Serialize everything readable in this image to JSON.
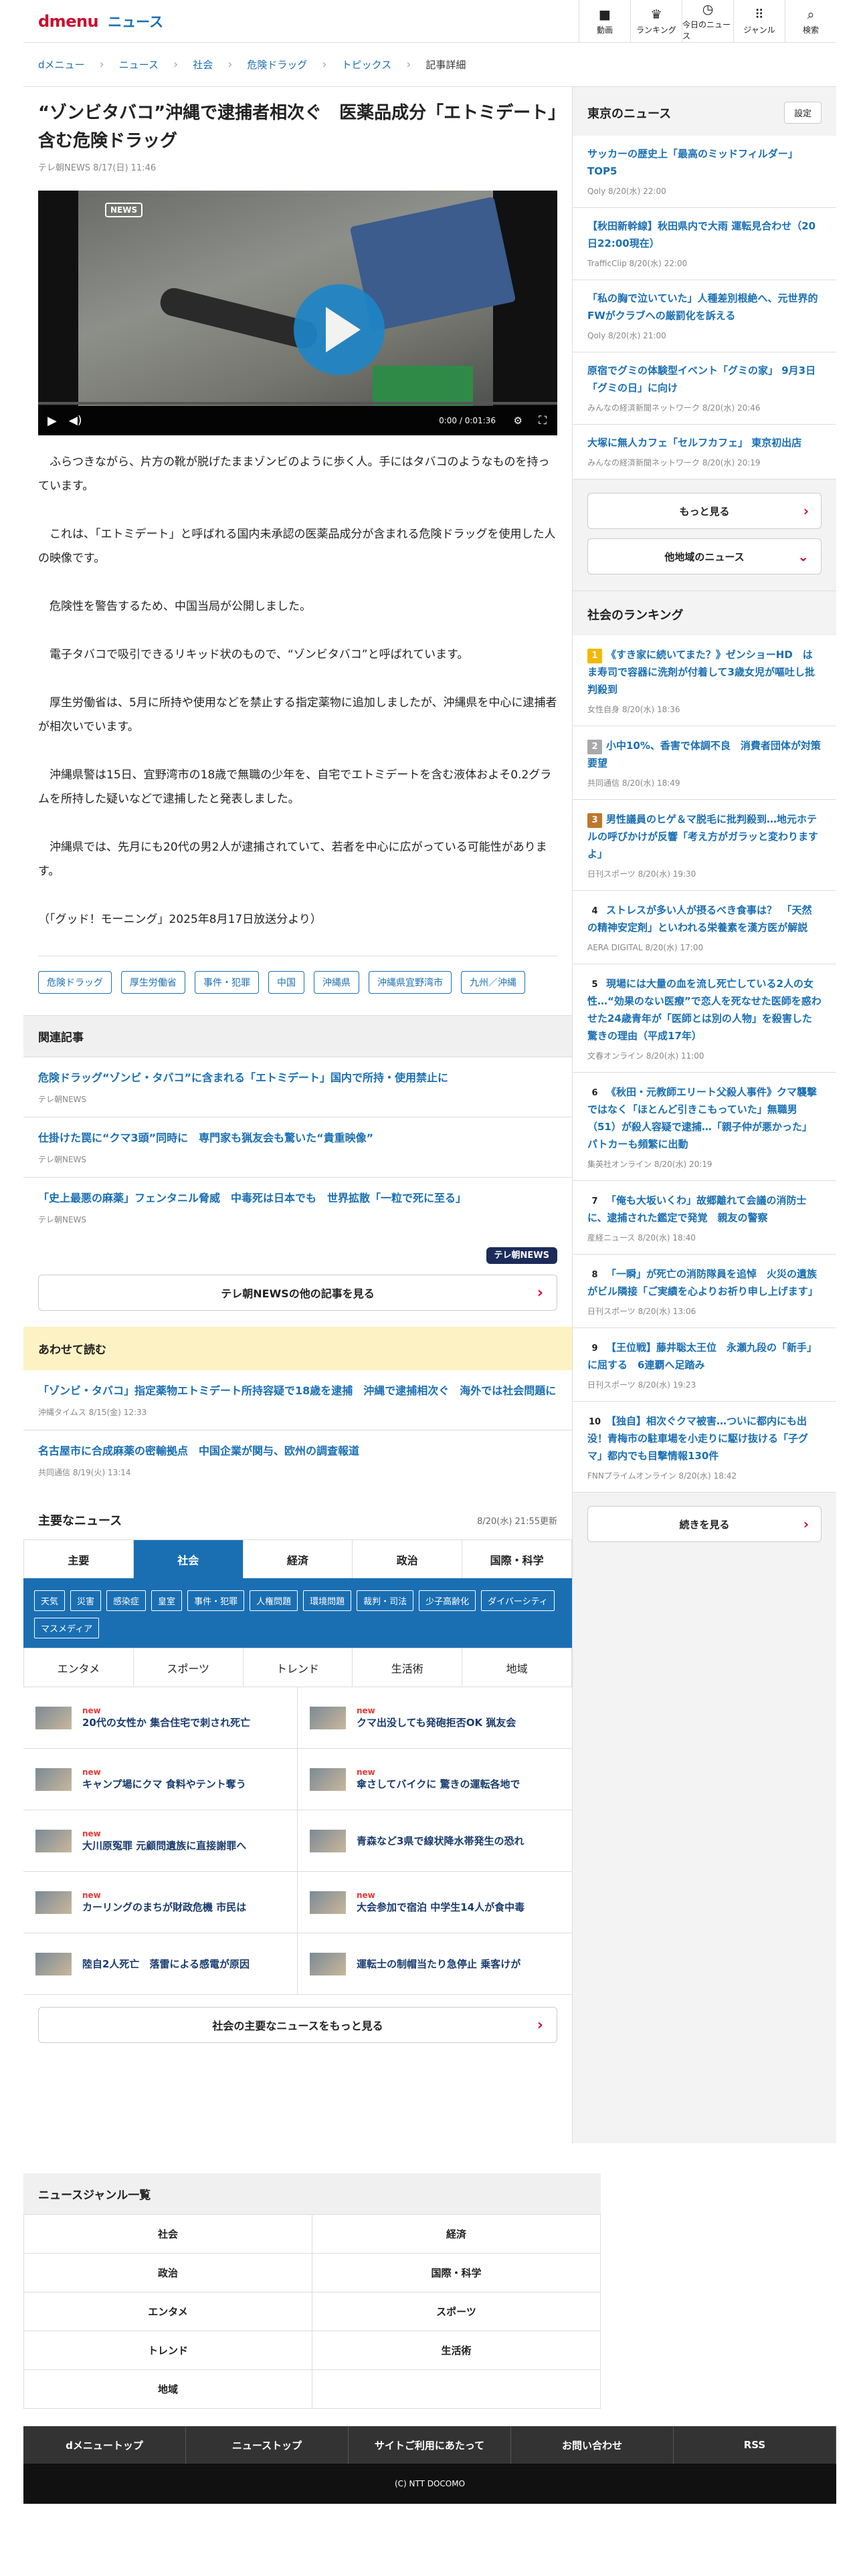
{
  "header": {
    "logo_d": "dmenu",
    "logo_n": "ニュース",
    "nav": [
      {
        "icon": "video-icon",
        "glyph": "■",
        "label": "動画"
      },
      {
        "icon": "trophy-icon",
        "glyph": "♛",
        "label": "ランキング"
      },
      {
        "icon": "clock-icon",
        "glyph": "◷",
        "label": "今日のニュース"
      },
      {
        "icon": "grid-icon",
        "glyph": "⠿",
        "label": "ジャンル"
      },
      {
        "icon": "search-icon",
        "glyph": "⌕",
        "label": "検索"
      }
    ]
  },
  "breadcrumb": [
    "dメニュー",
    "ニュース",
    "社会",
    "危険ドラッグ",
    "トピックス"
  ],
  "breadcrumb_current": "記事詳細",
  "article": {
    "title": "“ゾンビタバコ”沖縄で逮捕者相次ぐ　医薬品成分「エトミデート」含む危険ドラッグ",
    "meta": "テレ朝NEWS 8/17(日) 11:46",
    "video": {
      "badge": "NEWS",
      "time": "0:00 / 0:01:36"
    },
    "paragraphs": [
      "ふらつきながら、片方の靴が脱げたままゾンビのように歩く人。手にはタバコのようなものを持っています。",
      "これは、「エトミデート」と呼ばれる国内未承認の医薬品成分が含まれる危険ドラッグを使用した人の映像です。",
      "危険性を警告するため、中国当局が公開しました。",
      "電子タバコで吸引できるリキッド状のもので、“ゾンビタバコ”と呼ばれています。",
      "厚生労働省は、5月に所持や使用などを禁止する指定薬物に追加しましたが、沖縄県を中心に逮捕者が相次いでいます。",
      "沖縄県警は15日、宜野湾市の18歳で無職の少年を、自宅でエトミデートを含む液体およそ0.2グラムを所持した疑いなどで逮捕したと発表しました。",
      "沖縄県では、先月にも20代の男2人が逮捕されていて、若者を中心に広がっている可能性があります。",
      "（「グッド！モーニング」2025年8月17日放送分より）"
    ],
    "tags": [
      "危険ドラッグ",
      "厚生労働省",
      "事件・犯罪",
      "中国",
      "沖縄県",
      "沖縄県宜野湾市",
      "九州／沖縄"
    ]
  },
  "related": {
    "heading": "関連記事",
    "items": [
      {
        "title": "危険ドラッグ“ゾンビ・タバコ”に含まれる「エトミデート」国内で所持・使用禁止に",
        "src": "テレ朝NEWS"
      },
      {
        "title": "仕掛けた罠に“クマ3頭”同時に　専門家も猟友会も驚いた“貴重映像”",
        "src": "テレ朝NEWS"
      },
      {
        "title": "「史上最悪の麻薬」フェンタニル脅威　中毒死は日本でも　世界拡散「一粒で死に至る」",
        "src": "テレ朝NEWS"
      }
    ],
    "logo": "テレ朝NEWS",
    "more": "テレ朝NEWSの他の記事を見る"
  },
  "also": {
    "heading": "あわせて読む",
    "items": [
      {
        "title": "「ゾンビ・タバコ」指定薬物エトミデート所持容疑で18歳を逮捕　沖縄で逮捕相次ぐ　海外では社会問題に",
        "src": "沖縄タイムス 8/15(金) 12:33"
      },
      {
        "title": "名古屋市に合成麻薬の密輸拠点　中国企業が関与、欧州の調査報道",
        "src": "共同通信 8/19(火) 13:14"
      }
    ]
  },
  "major": {
    "heading": "主要なニュース",
    "updated": "8/20(水) 21:55更新",
    "tabs": [
      "主要",
      "社会",
      "経済",
      "政治",
      "国際・科学"
    ],
    "subtags": [
      "天気",
      "災害",
      "感染症",
      "皇室",
      "事件・犯罪",
      "人権問題",
      "環境問題",
      "裁判・司法",
      "少子高齢化",
      "ダイバーシティ",
      "マスメディア"
    ],
    "tabs2": [
      "エンタメ",
      "スポーツ",
      "トレンド",
      "生活術",
      "地域"
    ],
    "new_label": "new",
    "items": [
      {
        "t": "20代の女性か 集合住宅で刺され死亡",
        "n": true
      },
      {
        "t": "クマ出没しても発砲拒否OK 猟友会",
        "n": true
      },
      {
        "t": "キャンプ場にクマ 食料やテント奪う",
        "n": true
      },
      {
        "t": "傘さしてバイクに 驚きの運転各地で",
        "n": true
      },
      {
        "t": "大川原冤罪 元顧問遺族に直接謝罪へ",
        "n": true
      },
      {
        "t": "青森など3県で線状降水帯発生の恐れ",
        "n": false
      },
      {
        "t": "カーリングのまちが財政危機 市民は",
        "n": true
      },
      {
        "t": "大会参加で宿泊 中学生14人が食中毒",
        "n": true
      },
      {
        "t": "陸自2人死亡　落雷による感電が原因",
        "n": false
      },
      {
        "t": "運転士の制帽当たり急停止 乗客けが",
        "n": false
      }
    ],
    "more": "社会の主要なニュースをもっと見る"
  },
  "genre": {
    "heading": "ニュースジャンル一覧",
    "items": [
      "社会",
      "経済",
      "政治",
      "国際・科学",
      "エンタメ",
      "スポーツ",
      "トレンド",
      "生活術",
      "地域"
    ]
  },
  "footer": {
    "links": [
      "dメニュートップ",
      "ニューストップ",
      "サイトご利用にあたって",
      "お問い合わせ",
      "RSS"
    ],
    "copyright": "(C) NTT DOCOMO"
  },
  "sidebar": {
    "local": {
      "heading": "東京のニュース",
      "setting": "設定",
      "items": [
        {
          "t": "サッカーの歴史上「最高のミッドフィルダー」TOP5",
          "m": "Qoly 8/20(水) 22:00"
        },
        {
          "t": "【秋田新幹線】秋田県内で大雨 運転見合わせ（20日22:00現在）",
          "m": "TrafficClip 8/20(水) 22:00"
        },
        {
          "t": "「私の胸で泣いていた」人種差別根絶へ、元世界的FWがクラブへの厳罰化を訴える",
          "m": "Qoly 8/20(水) 21:00"
        },
        {
          "t": "原宿でグミの体験型イベント「グミの家」 9月3日「グミの日」に向け",
          "m": "みんなの経済新聞ネットワーク 8/20(水) 20:46"
        },
        {
          "t": "大塚に無人カフェ「セルフカフェ」 東京初出店",
          "m": "みんなの経済新聞ネットワーク 8/20(水) 20:19"
        }
      ],
      "more": "もっと見る",
      "other": "他地域のニュース"
    },
    "ranking": {
      "heading": "社会のランキング",
      "items": [
        {
          "n": "1",
          "t": "《すき家に続いてまた？》ゼンショーHD　はま寿司で容器に洗剤が付着して3歳女児が嘔吐し批判殺到",
          "m": "女性自身 8/20(水) 18:36",
          "c": "#f5b800"
        },
        {
          "n": "2",
          "t": "小中10%、香害で体調不良　消費者団体が対策要望",
          "m": "共同通信 8/20(水) 18:49",
          "c": "#a9a9a9"
        },
        {
          "n": "3",
          "t": "男性議員のヒゲ＆マ脱毛に批判殺到…地元ホテルの呼びかけが反響「考え方がガラッと変わりますよ」",
          "m": "日刊スポーツ 8/20(水) 19:30",
          "c": "#c0762d"
        },
        {
          "n": "4",
          "t": "ストレスが多い人が摂るべき食事は？　「天然の精神安定剤」といわれる栄養素を漢方医が解説",
          "m": "AERA DIGITAL 8/20(水) 17:00",
          "c": "#fff"
        },
        {
          "n": "5",
          "t": "現場には大量の血を流し死亡している2人の女性…“効果のない医療”で恋人を死なせた医師を惑わせた24歳青年が「医師とは別の人物」を殺害した驚きの理由（平成17年）",
          "m": "文春オンライン 8/20(水) 11:00",
          "c": "#fff"
        },
        {
          "n": "6",
          "t": "《秋田・元教師エリート父殺人事件》クマ襲撃ではなく「ほとんど引きこもっていた」無職男（51）が殺人容疑で逮捕…「親子仲が悪かった」パトカーも頻繁に出動",
          "m": "集英社オンライン 8/20(水) 20:19",
          "c": "#fff"
        },
        {
          "n": "7",
          "t": "「俺も大坂いくわ」故郷離れて会議の消防士に、逮捕された鑑定で発覚　親友の警察",
          "m": "産経ニュース 8/20(水) 18:40",
          "c": "#fff"
        },
        {
          "n": "8",
          "t": "「一瞬」が死亡の消防隊員を追悼　火災の遺族がビル隣接「ご実績を心よりお祈り申し上げます」",
          "m": "日刊スポーツ 8/20(水) 13:06",
          "c": "#fff"
        },
        {
          "n": "9",
          "t": "【王位戦】藤井聡太王位　永瀬九段の「新手」に屈する　6連覇へ足踏み",
          "m": "日刊スポーツ 8/20(水) 19:23",
          "c": "#fff"
        },
        {
          "n": "10",
          "t": "【独自】相次ぐクマ被害…ついに都内にも出没！青梅市の駐車場を小走りに駆け抜ける「子グマ」都内でも目撃情報130件",
          "m": "FNNプライムオンライン 8/20(水) 18:42",
          "c": "#fff"
        }
      ],
      "more": "続きを見る"
    }
  }
}
